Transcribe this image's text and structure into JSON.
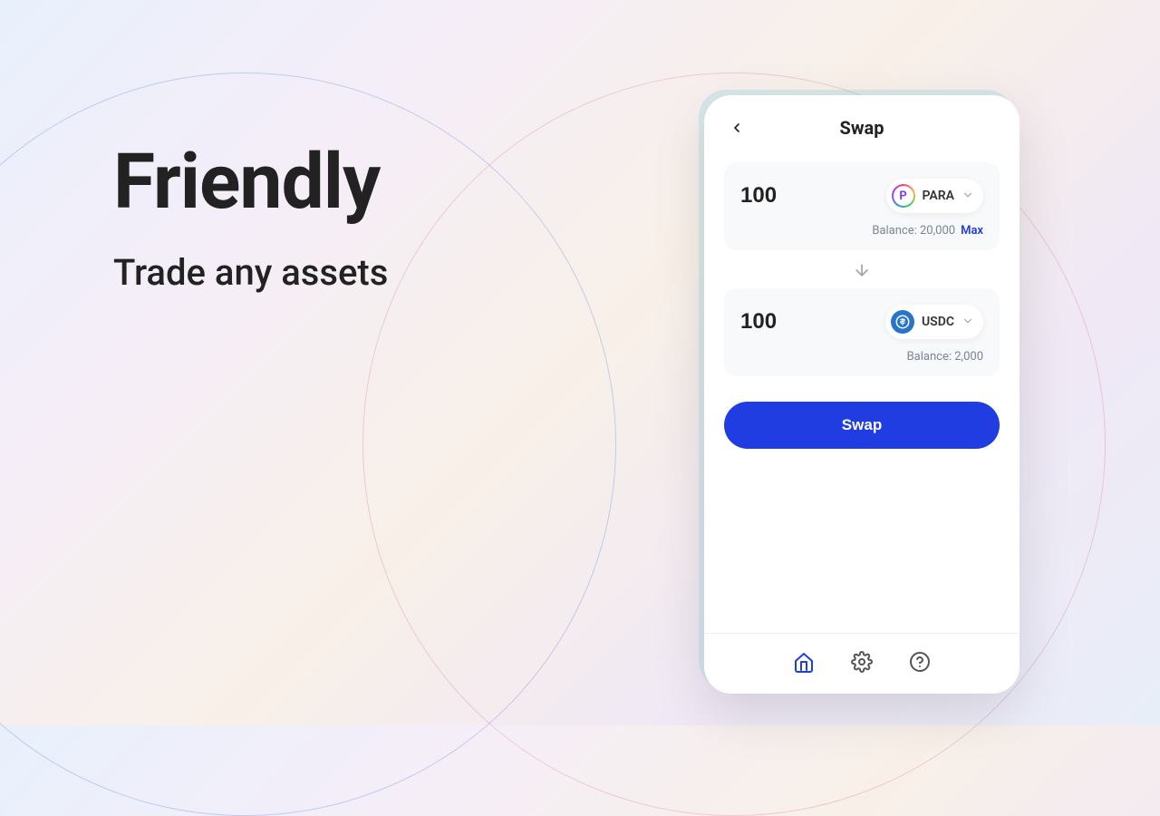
{
  "hero": {
    "title": "Friendly",
    "subtitle": "Trade any assets"
  },
  "swap": {
    "title": "Swap",
    "from": {
      "amount": "100",
      "token_symbol": "PARA",
      "token_initial": "P",
      "balance_label": "Balance: 20,000",
      "max_label": "Max"
    },
    "to": {
      "amount": "100",
      "token_symbol": "USDC",
      "balance_label": "Balance: 2,000"
    },
    "button_label": "Swap"
  },
  "colors": {
    "primary": "#1f3de0",
    "usdc": "#2775ca"
  }
}
